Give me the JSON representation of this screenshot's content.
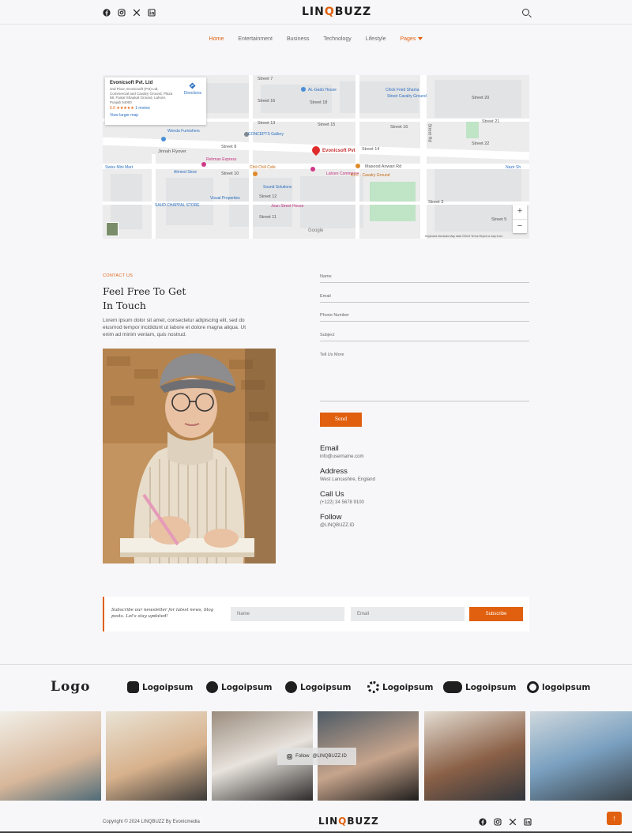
{
  "header": {
    "brand_prefix": "LIN",
    "brand_accent": "Q",
    "brand_suffix": "BUZZ",
    "social_icons": [
      "facebook-icon",
      "instagram-icon",
      "x-icon",
      "linkedin-icon"
    ],
    "search_icon": "search-icon"
  },
  "nav": {
    "items": [
      {
        "label": "Home",
        "active": true
      },
      {
        "label": "Entertainment",
        "active": false
      },
      {
        "label": "Business",
        "active": false
      },
      {
        "label": "Technology",
        "active": false
      },
      {
        "label": "Lifestyle",
        "active": false
      },
      {
        "label": "Pages",
        "active": false,
        "dropdown": true
      }
    ]
  },
  "map": {
    "place_name": "Evonicsoft Pvt. Ltd",
    "address": "2nd Floor, Evonicsoft (Pvt) Ltd, Commercial and Cavalry Ground, Plaza 58, Faisal Shaukat Ground, Lahore, Punjab 54000",
    "rating": "5.0",
    "stars": "★★★★★",
    "reviews": "1 review",
    "view_larger": "View larger map",
    "directions": "Directions",
    "pin_label": "Evonicsoft Pvt",
    "streets": [
      "Street 7",
      "Street 16",
      "Street 18",
      "Street 13",
      "Street 15",
      "Street 20",
      "Street 21",
      "Street 22",
      "Street 14",
      "Street 16",
      "Street 8",
      "Street 10",
      "Street 12",
      "Street 11",
      "Street 3",
      "Street 5",
      "Jinnah Flyover",
      "Masood Anwari Rd",
      "Street Rd"
    ],
    "pois": [
      {
        "label": "Chick Fried Shama",
        "color": "blue"
      },
      {
        "label": "AL-Gado House",
        "color": "blue"
      },
      {
        "label": "Street Cavalry Ground",
        "color": "blue"
      },
      {
        "label": "Wonda Furnishers",
        "color": "blue"
      },
      {
        "label": "CONCEPTS Gallery",
        "color": "blue"
      },
      {
        "label": "Rehman Express",
        "color": "pink"
      },
      {
        "label": "Chili Chili Cafe",
        "color": "orange"
      },
      {
        "label": "Lahore Commerce",
        "color": "pink"
      },
      {
        "label": "KFC - Cavalry Ground",
        "color": "orange"
      },
      {
        "label": "Ahmed Store",
        "color": "blue"
      },
      {
        "label": "Sound Solutions",
        "color": "blue"
      },
      {
        "label": "Visual Properties",
        "color": "blue"
      },
      {
        "label": "SAUD CHAPPAL STORE",
        "color": "blue"
      },
      {
        "label": "Swiss Mini Mart",
        "color": "blue"
      },
      {
        "label": "Jean Street House",
        "color": "pink"
      },
      {
        "label": "Evonicsoft Pvt",
        "color": "red"
      },
      {
        "label": "Nazir Sh",
        "color": "blue"
      }
    ],
    "google": "Google",
    "footer": "Keyboard shortcuts   Map data ©2024   Terms   Report a map error",
    "zoom_in": "+",
    "zoom_out": "−"
  },
  "contact": {
    "eyebrow": "CONTACT US",
    "title_line1": "Feel Free To Get",
    "title_line2": "In Touch",
    "text": "Lorem ipsum dolor sit amet, consectetur adipiscing elit, sed do eiusmod tempor incididunt ut labore et dolore magna aliqua. Ut enim ad minim veniam, quis nostrud.",
    "photo_alt": "woman-writing-photo",
    "form": {
      "name": "Name",
      "email": "Email",
      "phone": "Phone Number",
      "subject": "Subject",
      "message": "Tell Us More",
      "send": "Send"
    },
    "info": [
      {
        "heading": "Email",
        "value": "info@username.com"
      },
      {
        "heading": "Address",
        "value": "West Lancashire, England"
      },
      {
        "heading": "Call Us",
        "value": "(+122) 34 5678 9100"
      },
      {
        "heading": "Follow",
        "value": "@LINQBUZZ.ID"
      }
    ]
  },
  "newsletter": {
    "text": "Subscribe our newsletter for latest news, blog posts. Let's stay updated!",
    "name_placeholder": "Name",
    "email_placeholder": "Email",
    "button": "Subscribe"
  },
  "brands": {
    "script_logo": "Logo",
    "items": [
      "Logoipsum",
      "Logoipsum",
      "Logoipsum",
      "Logoipsum",
      "Logoipsum",
      "logoipsum"
    ]
  },
  "gallery": {
    "follow_text": "Follow",
    "follow_handle": "@LINQBUZZ.ID"
  },
  "footer": {
    "copyright": "Copyright © 2024 LINQBUZZ By Evonicmedia",
    "brand_prefix": "LIN",
    "brand_accent": "Q",
    "brand_suffix": "BUZZ",
    "back_to_top": "↑"
  },
  "colors": {
    "accent": "#e0600f",
    "background": "#f7f7f9"
  }
}
